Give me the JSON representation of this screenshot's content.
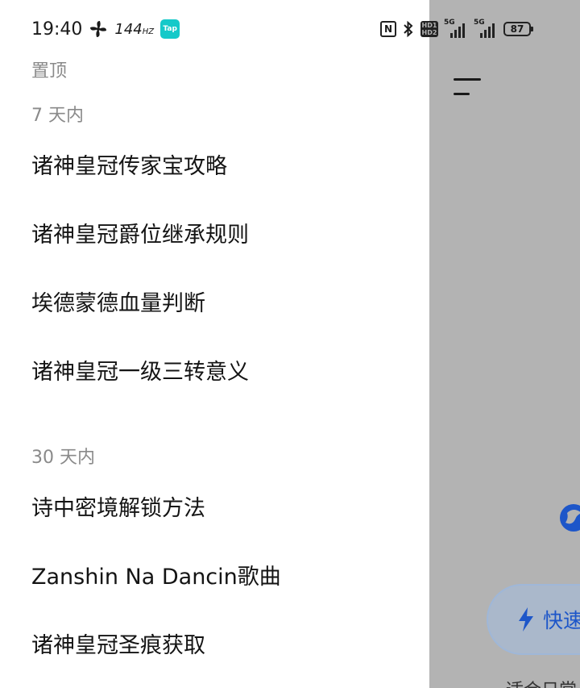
{
  "status_bar": {
    "time": "19:40",
    "refresh_rate": "144",
    "refresh_unit": "HZ",
    "tap_badge": "Tap",
    "nfc": "N",
    "hd_top": "HD1",
    "hd_bottom": "HD2",
    "signal1": "5G",
    "signal2": "5G",
    "battery": "87"
  },
  "drawer": {
    "pinned_label": "置顶",
    "sections": [
      {
        "label": "7 天内",
        "items": [
          "诸神皇冠传家宝攻略",
          "诸神皇冠爵位继承规则",
          "埃德蒙德血量判断",
          "诸神皇冠一级三转意义"
        ]
      },
      {
        "label": "30 天内",
        "items": [
          "诗中密境解锁方法",
          "Zanshin Na Dancin歌曲",
          "诸神皇冠圣痕获取"
        ]
      }
    ]
  },
  "background": {
    "quick_button_label": "快速",
    "bottom_text": "适合日常"
  },
  "colors": {
    "overlay": "#b3b3b3",
    "accent": "#1d56c9",
    "section_label": "#8a8a8a"
  }
}
